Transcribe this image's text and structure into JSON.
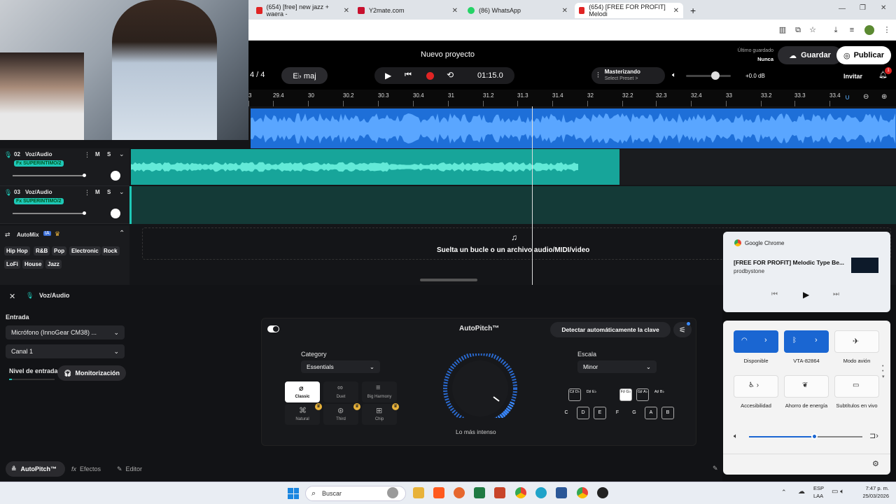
{
  "browser": {
    "tabs": [
      {
        "label": "(654) [free] new jazz + waera -",
        "color": "#e02424"
      },
      {
        "label": "Y2mate.com",
        "color": "#c8102e"
      },
      {
        "label": "(86) WhatsApp",
        "color": "#25d366"
      },
      {
        "label": "(654) [FREE FOR PROFIT] Melodi",
        "color": "#e02424"
      }
    ],
    "new_tab": "+"
  },
  "header": {
    "project_title": "Nuevo proyecto",
    "last_saved_label": "Último guardado",
    "last_saved_value": "Nunca",
    "save_label": "Guardar",
    "publish_label": "Publicar",
    "time_signature": "4 / 4",
    "key": "E♭ maj",
    "time": "01:15.0",
    "mastering_label": "Masterizando",
    "mastering_preset": "Select Preset >",
    "volume_db": "+0.0 dB",
    "invite_label": "Invitar",
    "notif_count": "1"
  },
  "ruler": {
    "ticks": [
      "3",
      "29.4",
      "30",
      "30.2",
      "30.3",
      "30.4",
      "31",
      "31.2",
      "31.3",
      "31.4",
      "32",
      "32.2",
      "32.3",
      "32.4",
      "33",
      "33.2",
      "33.3",
      "33.4"
    ]
  },
  "tracks": [
    {
      "number": "02",
      "name": "Voz/Audio",
      "fx": "Fx SUPERINTIMO/2",
      "m": "M",
      "s": "S"
    },
    {
      "number": "03",
      "name": "Voz/Audio",
      "fx": "Fx SUPERINTIMO/2",
      "m": "M",
      "s": "S"
    }
  ],
  "automix": {
    "label": "AutoMix",
    "ia": "IA",
    "genres": [
      "Hip Hop",
      "R&B",
      "Pop",
      "Electronic",
      "Rock",
      "LoFi",
      "House",
      "Jazz"
    ]
  },
  "dropzone": {
    "text": "Suelta un bucle o un archivo audio/MIDI/video"
  },
  "panel": {
    "title": "Voz/Audio",
    "input_label": "Entrada",
    "mic_value": "Micrófono (InnoGear CM38) ...",
    "channel_value": "Canal 1",
    "level_label": "Nivel de entrada",
    "monitor_label": "Monitorización"
  },
  "autopitch": {
    "title": "AutoPitch™",
    "detect_label": "Detectar automáticamente la clave",
    "category_label": "Category",
    "category_value": "Essentials",
    "scale_label": "Escala",
    "scale_value": "Minor",
    "knob_label": "Lo más intenso",
    "styles": [
      "Classic",
      "Duet",
      "Big Harmony",
      "Natural",
      "Third",
      "Chip"
    ],
    "notes_top": [
      "C♯ D♭",
      "D♯ E♭",
      "F♯ G♭",
      "G♯ A♭",
      "A♯ B♭"
    ],
    "notes_bottom": [
      "C",
      "D",
      "E",
      "F",
      "G",
      "A",
      "B"
    ]
  },
  "bottom_tabs": [
    "AutoPitch™",
    "Efectos",
    "Editor"
  ],
  "media": {
    "app": "Google Chrome",
    "title": "[FREE FOR PROFIT] Melodic Type Be...",
    "artist": "prodbystone"
  },
  "quick_settings": {
    "wifi": "Disponible",
    "bluetooth": "VTA-82864",
    "airplane": "Modo avión",
    "accessibility": "Accesibilidad",
    "energy": "Ahorro de energía",
    "subtitles": "Subtítulos en vivo",
    "volume_level": 0.58
  },
  "taskbar": {
    "search": "Buscar",
    "lang": "ESP",
    "region": "LAA",
    "time": "7:47 p. m.",
    "date": "25/03/2026"
  }
}
